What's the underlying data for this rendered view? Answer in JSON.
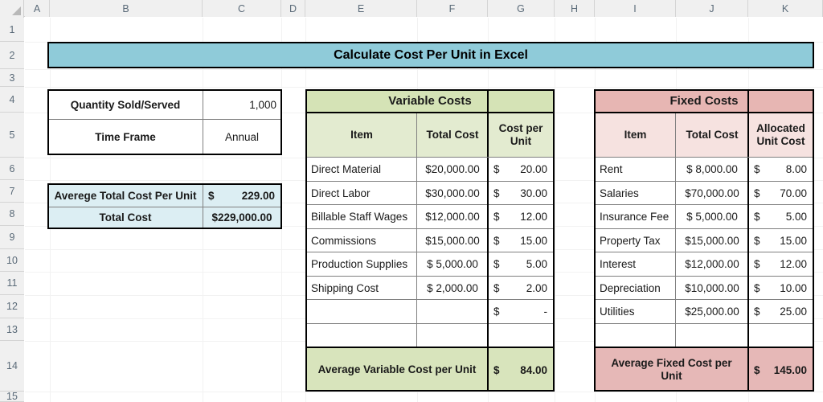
{
  "app": {
    "type": "spreadsheet",
    "title": "Calculate Cost Per Unit in Excel"
  },
  "grid": {
    "column_headers": [
      "A",
      "B",
      "C",
      "D",
      "E",
      "F",
      "G",
      "H",
      "I",
      "J",
      "K"
    ],
    "row_headers": [
      "1",
      "2",
      "3",
      "4",
      "5",
      "6",
      "7",
      "8",
      "9",
      "10",
      "11",
      "12",
      "13",
      "14",
      "15"
    ]
  },
  "banner": {
    "text": "Calculate Cost Per Unit in Excel",
    "fill": "#8fcbd9"
  },
  "inputs_table": {
    "rows": [
      {
        "label": "Quantity Sold/Served",
        "value": "1,000",
        "align": "right"
      },
      {
        "label": "Time Frame",
        "value": "Annual",
        "align": "center"
      }
    ]
  },
  "summary_table": {
    "fill": "#dceef3",
    "rows": [
      {
        "label": "Averege Total Cost Per Unit",
        "symbol": "$",
        "amount": "229.00"
      },
      {
        "label": "Total Cost",
        "value": "$229,000.00"
      }
    ]
  },
  "variable_costs": {
    "title": "Variable Costs",
    "header_fill": "#d5e3b6",
    "subheader_fill": "#e3ebd0",
    "total_fill": "#d8e4bc",
    "columns": [
      "Item",
      "Total Cost",
      "Cost per Unit"
    ],
    "rows": [
      {
        "item": "Direct Material",
        "total_cost": "$20,000.00",
        "unit_symbol": "$",
        "unit_cost": "20.00"
      },
      {
        "item": "Direct Labor",
        "total_cost": "$30,000.00",
        "unit_symbol": "$",
        "unit_cost": "30.00"
      },
      {
        "item": "Billable Staff Wages",
        "total_cost": "$12,000.00",
        "unit_symbol": "$",
        "unit_cost": "12.00"
      },
      {
        "item": "Commissions",
        "total_cost": "$15,000.00",
        "unit_symbol": "$",
        "unit_cost": "15.00"
      },
      {
        "item": "Production Supplies",
        "total_cost": "$ 5,000.00",
        "unit_symbol": "$",
        "unit_cost": "5.00"
      },
      {
        "item": "Shipping Cost",
        "total_cost": "$ 2,000.00",
        "unit_symbol": "$",
        "unit_cost": "2.00"
      },
      {
        "item": "",
        "total_cost": "",
        "unit_symbol": "$",
        "unit_cost": "-"
      },
      {
        "item": "",
        "total_cost": "",
        "unit_symbol": "",
        "unit_cost": ""
      }
    ],
    "total_row": {
      "label": "Average Variable Cost per Unit",
      "symbol": "$",
      "amount": "84.00"
    }
  },
  "fixed_costs": {
    "title": "Fixed Costs",
    "header_fill": "#e7b6b3",
    "subheader_fill": "#f6e2e0",
    "total_fill": "#e6b8b7",
    "columns": [
      "Item",
      "Total Cost",
      "Allocated Unit Cost"
    ],
    "rows": [
      {
        "item": "Rent",
        "total_cost": "$  8,000.00",
        "unit_symbol": "$",
        "unit_cost": "8.00"
      },
      {
        "item": "Salaries",
        "total_cost": "$70,000.00",
        "unit_symbol": "$",
        "unit_cost": "70.00"
      },
      {
        "item": "Insurance Fee",
        "total_cost": "$  5,000.00",
        "unit_symbol": "$",
        "unit_cost": "5.00"
      },
      {
        "item": "Property Tax",
        "total_cost": "$15,000.00",
        "unit_symbol": "$",
        "unit_cost": "15.00"
      },
      {
        "item": "Interest",
        "total_cost": "$12,000.00",
        "unit_symbol": "$",
        "unit_cost": "12.00"
      },
      {
        "item": "Depreciation",
        "total_cost": "$10,000.00",
        "unit_symbol": "$",
        "unit_cost": "10.00"
      },
      {
        "item": "Utilities",
        "total_cost": "$25,000.00",
        "unit_symbol": "$",
        "unit_cost": "25.00"
      },
      {
        "item": "",
        "total_cost": "",
        "unit_symbol": "",
        "unit_cost": ""
      }
    ],
    "total_row": {
      "label": "Average Fixed Cost per Unit",
      "symbol": "$",
      "amount": "145.00"
    }
  }
}
